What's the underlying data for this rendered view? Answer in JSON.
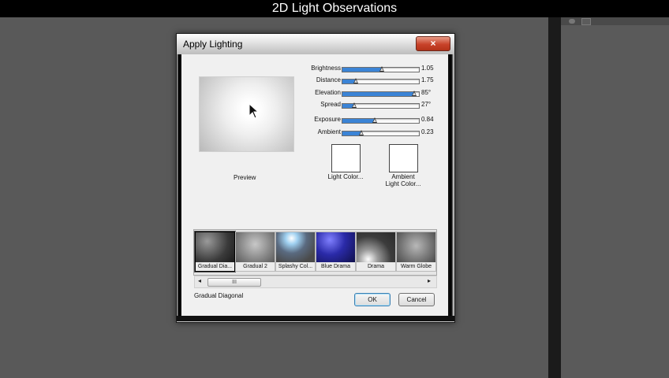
{
  "video_title": "2D Light Observations",
  "dialog": {
    "title": "Apply Lighting",
    "close_glyph": "×",
    "preview_label": "Preview",
    "sliders": [
      {
        "label": "Brightness",
        "value_text": "1.05",
        "fraction": 0.52
      },
      {
        "label": "Distance",
        "value_text": "1.75",
        "fraction": 0.18
      },
      {
        "label": "Elevation",
        "value_text": "85°",
        "fraction": 0.94
      },
      {
        "label": "Spread",
        "value_text": "27°",
        "fraction": 0.15
      },
      {
        "label": "Exposure",
        "value_text": "0.84",
        "fraction": 0.42
      },
      {
        "label": "Ambient",
        "value_text": "0.23",
        "fraction": 0.25
      }
    ],
    "light_color_label": "Light Color...",
    "ambient_color_label_line1": "Ambient",
    "ambient_color_label_line2": "Light Color...",
    "presets": [
      {
        "name": "Gradual Dia...",
        "style": "gradual"
      },
      {
        "name": "Gradual 2",
        "style": "gradual2"
      },
      {
        "name": "Splashy Col...",
        "style": "splashy"
      },
      {
        "name": "Blue Drama",
        "style": "blue"
      },
      {
        "name": "Drama",
        "style": "drama"
      },
      {
        "name": "Warm Globe",
        "style": "warm"
      }
    ],
    "selected_preset_index": 0,
    "selected_preset_name": "Gradual Diagonal",
    "scroll_grip": "III",
    "scroll_left": "◂",
    "scroll_right": "▸",
    "ok_label": "OK",
    "cancel_label": "Cancel"
  },
  "colors": {
    "slider_fill": "#3b84d6",
    "close_button": "#c8432a",
    "background": "#595959"
  }
}
